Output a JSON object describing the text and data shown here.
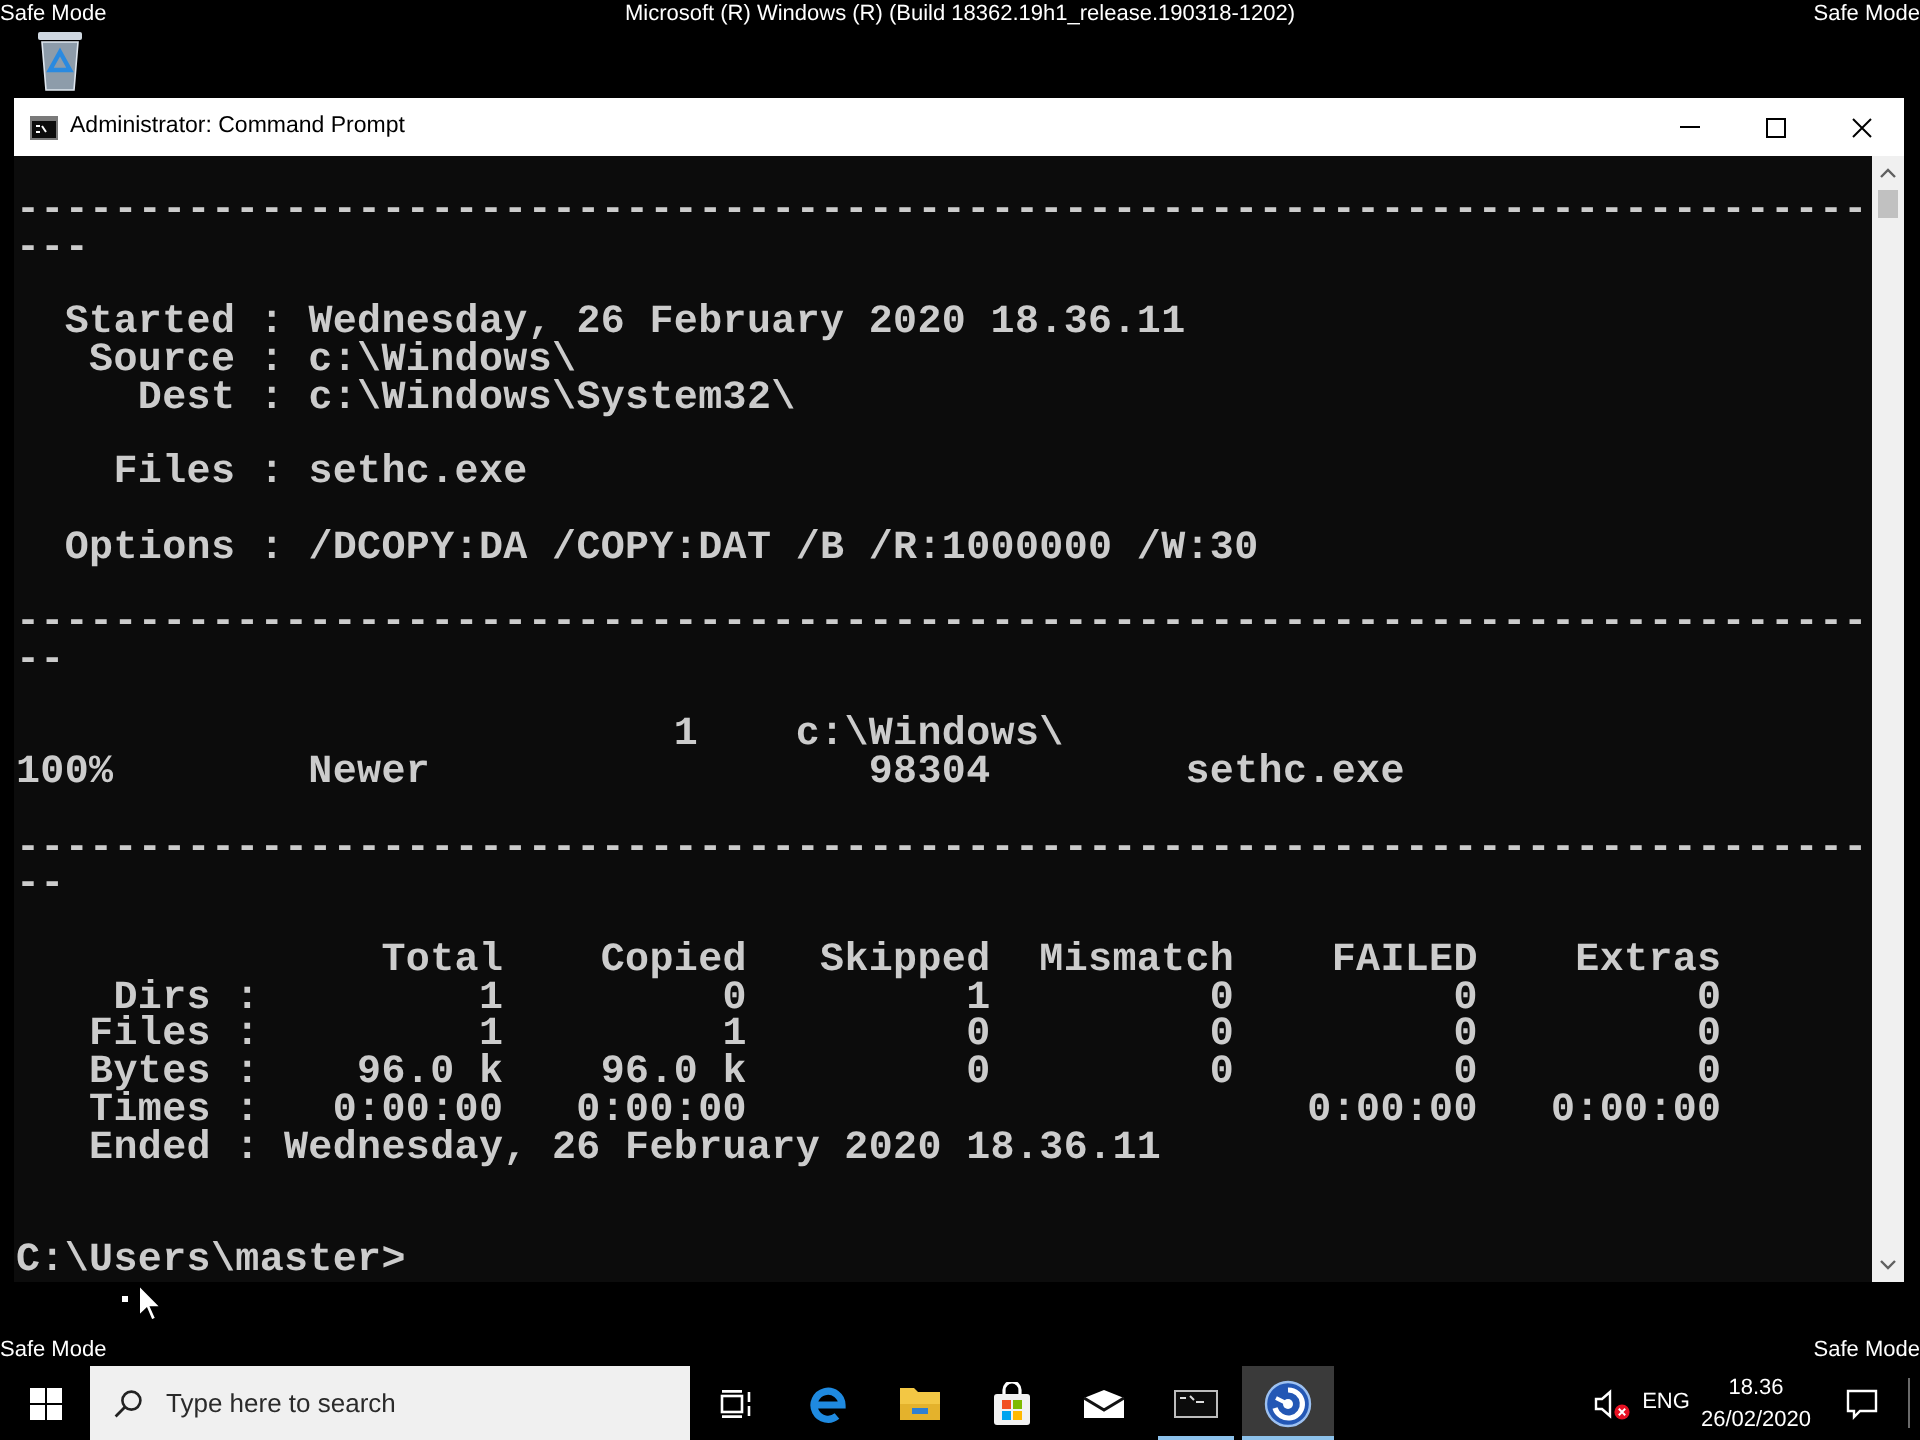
{
  "desktop": {
    "top_left_label": "Safe Mode",
    "build_label": "Microsoft (R) Windows (R) (Build 18362.19h1_release.190318-1202)",
    "top_right_label": "Safe Mode",
    "bottom_left_label": "Safe Mode",
    "bottom_right_label": "Safe Mode"
  },
  "window": {
    "title": "Administrator: Command Prompt",
    "console": {
      "blocks": [
        {
          "lines": [
            "----------------------------------------------------------------------------",
            "---"
          ]
        },
        {
          "lines": [
            "  Started : Wednesday, 26 February 2020 18.36.11",
            "   Source : c:\\Windows\\",
            "     Dest : c:\\Windows\\System32\\"
          ]
        },
        {
          "lines": [
            "    Files : sethc.exe"
          ]
        },
        {
          "lines": [
            "  Options : /DCOPY:DA /COPY:DAT /B /R:1000000 /W:30"
          ]
        },
        {
          "lines": [
            "----------------------------------------------------------------------------",
            "--"
          ]
        },
        {
          "lines": [
            "                           1    c:\\Windows\\",
            "100%        Newer                  98304        sethc.exe"
          ]
        },
        {
          "lines": [
            "----------------------------------------------------------------------------",
            "--"
          ]
        },
        {
          "lines": [
            "               Total    Copied   Skipped  Mismatch    FAILED    Extras",
            "    Dirs :         1         0         1         0         0         0",
            "   Files :         1         1         0         0         0         0",
            "   Bytes :    96.0 k    96.0 k         0         0         0         0",
            "   Times :   0:00:00   0:00:00                       0:00:00   0:00:00",
            "   Ended : Wednesday, 26 February 2020 18.36.11"
          ]
        }
      ],
      "prompt": "C:\\Users\\master>"
    }
  },
  "taskbar": {
    "search": {
      "placeholder": "Type here to search"
    },
    "apps": [
      {
        "running": false,
        "active": false
      },
      {
        "running": false,
        "active": false
      },
      {
        "running": false,
        "active": false
      },
      {
        "running": false,
        "active": false
      },
      {
        "running": true,
        "active": false
      },
      {
        "running": true,
        "active": true
      }
    ],
    "tray": {
      "muted": true,
      "language": "ENG",
      "time": "18.36",
      "date": "26/02/2020"
    }
  }
}
